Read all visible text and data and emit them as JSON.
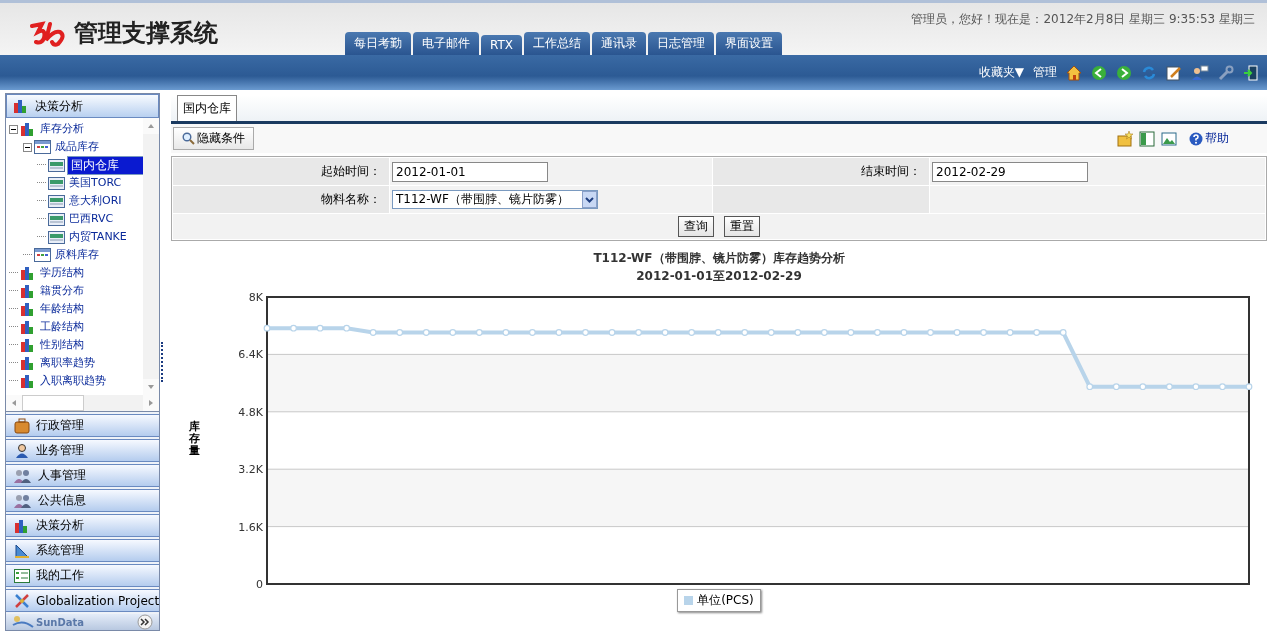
{
  "header": {
    "system_name": "管理支撑系统",
    "greeting": "管理员，您好！现在是：2012年2月8日 星期三 9:35:53 星期三",
    "tabs": [
      {
        "label": "每日考勤",
        "selected": false
      },
      {
        "label": "电子邮件",
        "selected": false
      },
      {
        "label": "RTX",
        "selected": false
      },
      {
        "label": "工作总结",
        "selected": false
      },
      {
        "label": "通讯录",
        "selected": false
      },
      {
        "label": "日志管理",
        "selected": false
      },
      {
        "label": "界面设置",
        "selected": false
      }
    ]
  },
  "toolbar": {
    "favorites": "收藏夹▼",
    "manage": "管理"
  },
  "sidebar": {
    "title": "决策分析",
    "tree": [
      {
        "label": "库存分析",
        "expanded": true,
        "selected": false,
        "children": [
          {
            "label": "成品库存",
            "expanded": true,
            "selected": false,
            "children": [
              {
                "label": "国内仓库",
                "selected": true
              },
              {
                "label": "美国TORC",
                "selected": false
              },
              {
                "label": "意大利ORI",
                "selected": false
              },
              {
                "label": "巴西RVC",
                "selected": false
              },
              {
                "label": "内贸TANKE",
                "selected": false
              }
            ]
          },
          {
            "label": "原料库存",
            "selected": false
          }
        ]
      },
      {
        "label": "学历结构",
        "selected": false
      },
      {
        "label": "籍贯分布",
        "selected": false
      },
      {
        "label": "年龄结构",
        "selected": false
      },
      {
        "label": "工龄结构",
        "selected": false
      },
      {
        "label": "性别结构",
        "selected": false
      },
      {
        "label": "离职率趋势",
        "selected": false
      },
      {
        "label": "入职离职趋势",
        "selected": false
      }
    ],
    "sections": [
      {
        "label": "行政管理",
        "kind": "briefcase"
      },
      {
        "label": "业务管理",
        "kind": "person"
      },
      {
        "label": "人事管理",
        "kind": "people"
      },
      {
        "label": "公共信息",
        "kind": "people"
      },
      {
        "label": "决策分析",
        "kind": "chart"
      },
      {
        "label": "系统管理",
        "kind": "ruler"
      },
      {
        "label": "我的工作",
        "kind": "list"
      },
      {
        "label": "Globalization Project",
        "kind": "tools"
      }
    ],
    "footer_logo": "SunData"
  },
  "main": {
    "tabs": [
      {
        "label": "国内仓库",
        "selected": true
      }
    ],
    "hide_button": "隐藏条件",
    "help": "帮助",
    "form": {
      "start_label": "起始时间：",
      "start_value": "2012-01-01",
      "end_label": "结束时间：",
      "end_value": "2012-02-29",
      "material_label": "物料名称：",
      "material_value": "T112-WF（带围脖、镜片防雾）",
      "buttons": [
        "查询",
        "重置"
      ]
    },
    "chart": {
      "subtitle": "2012-01-01至2012-02-29",
      "chart_data": {
        "type": "line",
        "grid": true,
        "title": "T112-WF（带围脖、镜片防雾）库存趋势分析",
        "ylabel": "库存量",
        "ylim": [
          0,
          8000
        ],
        "yticks": [
          {
            "value": 0,
            "label": "0"
          },
          {
            "value": 1600,
            "label": "1.6K"
          },
          {
            "value": 3200,
            "label": "3.2K"
          },
          {
            "value": 4800,
            "label": "4.8K"
          },
          {
            "value": 6400,
            "label": "6.4K"
          },
          {
            "value": 8000,
            "label": "8K"
          }
        ],
        "series": [
          {
            "name": "单位(PCS)",
            "color": "#b8d4ea",
            "marker": "circle",
            "values": [
              7130,
              7130,
              7130,
              7130,
              7010,
              7010,
              7010,
              7010,
              7010,
              7010,
              7010,
              7010,
              7010,
              7010,
              7010,
              7010,
              7010,
              7010,
              7010,
              7010,
              7010,
              7010,
              7010,
              7010,
              7010,
              7010,
              7010,
              7010,
              7010,
              7010,
              7010,
              5500,
              5500,
              5500,
              5500,
              5500,
              5500,
              5500
            ]
          }
        ]
      }
    }
  }
}
